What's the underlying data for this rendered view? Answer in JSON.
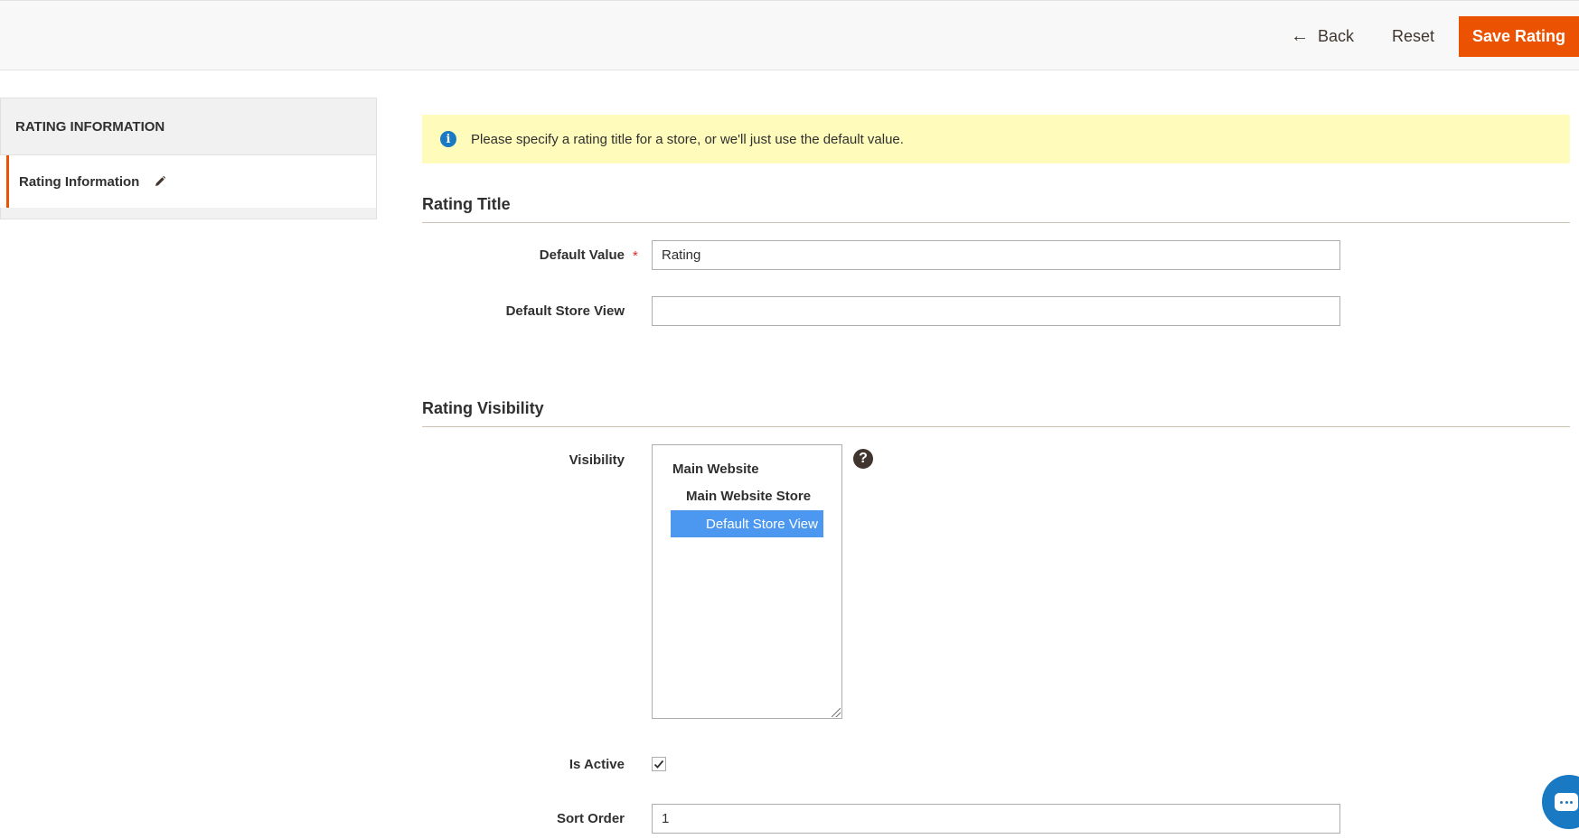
{
  "toolbar": {
    "back_label": "Back",
    "reset_label": "Reset",
    "save_label": "Save Rating",
    "accent_color": "#eb5202"
  },
  "sidebar": {
    "heading": "RATING INFORMATION",
    "items": [
      {
        "label": "Rating Information",
        "icon": "pencil-icon",
        "active": true
      }
    ]
  },
  "notice": {
    "icon": "info-icon",
    "text": "Please specify a rating title for a store, or we'll just use the default value."
  },
  "rating_title": {
    "section_title": "Rating Title",
    "default_value": {
      "label": "Default Value",
      "required_mark": "*",
      "value": "Rating"
    },
    "default_store_view": {
      "label": "Default Store View",
      "value": ""
    }
  },
  "rating_visibility": {
    "section_title": "Rating Visibility",
    "visibility": {
      "label": "Visibility",
      "website": "Main Website",
      "store": "Main Website Store",
      "selected_option": "Default Store View",
      "help_icon": "question-icon"
    },
    "is_active": {
      "label": "Is Active",
      "checked": true
    },
    "sort_order": {
      "label": "Sort Order",
      "value": "1"
    }
  },
  "chat": {
    "icon": "chat-icon"
  }
}
